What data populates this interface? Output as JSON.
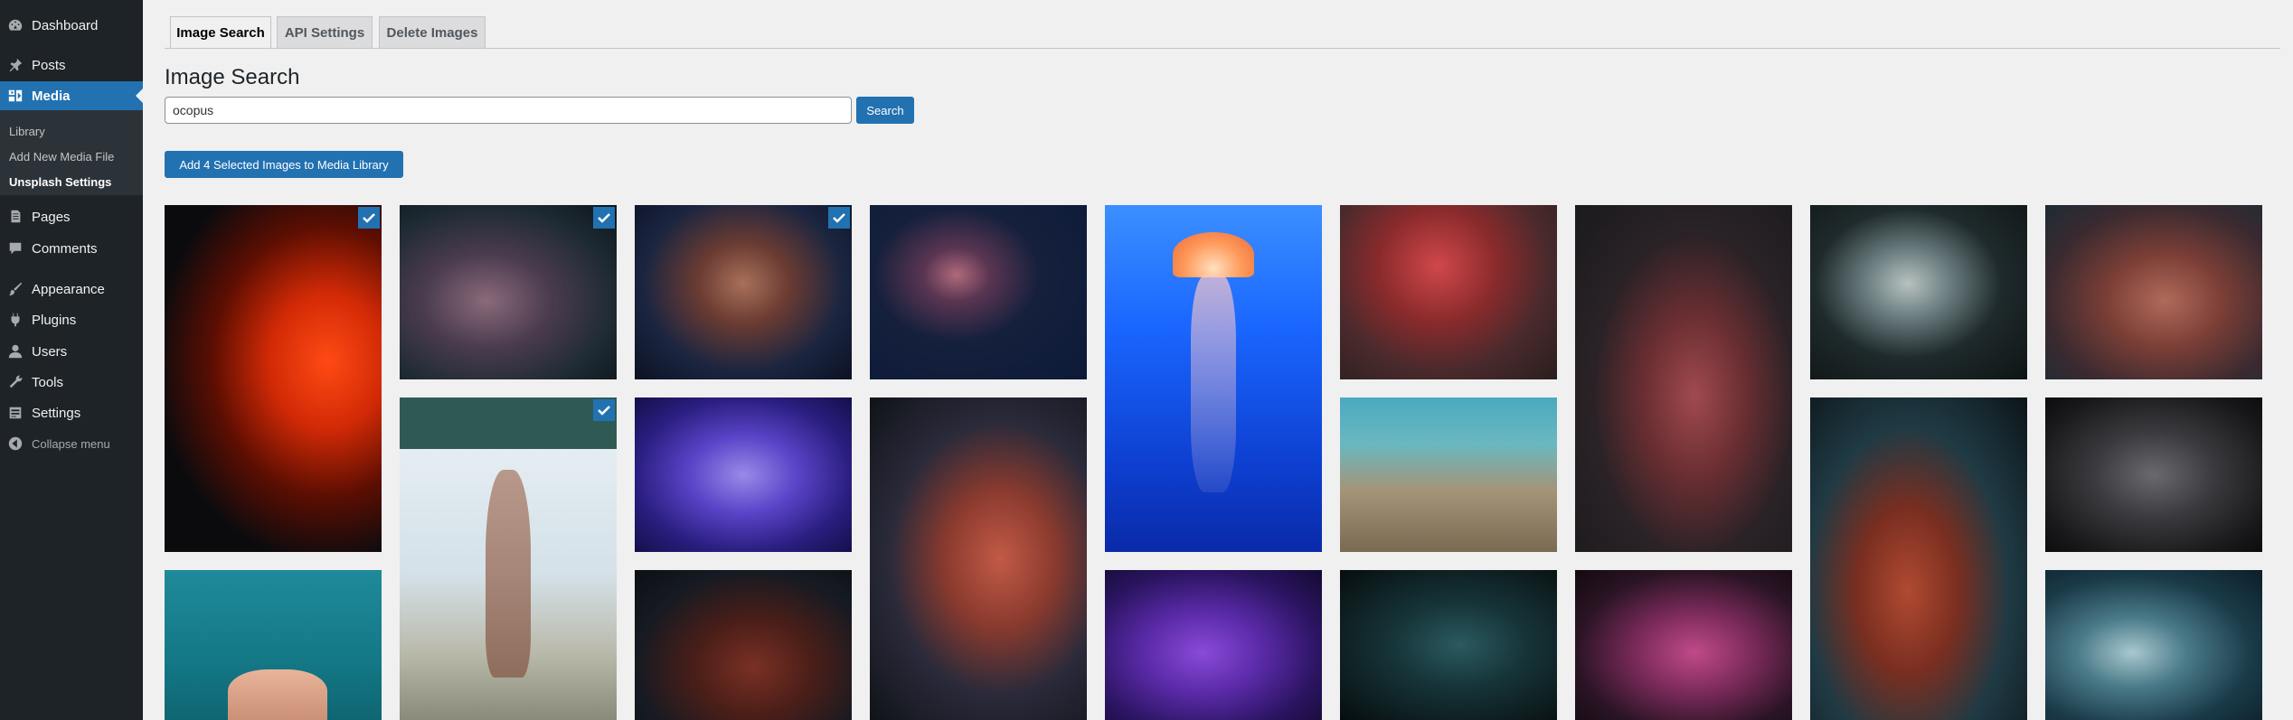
{
  "sidebar": {
    "items": [
      {
        "label": "Dashboard",
        "icon": "dashboard-icon"
      },
      {
        "label": "Posts",
        "icon": "pin-icon"
      },
      {
        "label": "Media",
        "icon": "media-icon"
      },
      {
        "label": "Pages",
        "icon": "pages-icon"
      },
      {
        "label": "Comments",
        "icon": "comment-icon"
      },
      {
        "label": "Appearance",
        "icon": "brush-icon"
      },
      {
        "label": "Plugins",
        "icon": "plug-icon"
      },
      {
        "label": "Users",
        "icon": "user-icon"
      },
      {
        "label": "Tools",
        "icon": "wrench-icon"
      },
      {
        "label": "Settings",
        "icon": "settings-icon"
      }
    ],
    "submenu": [
      "Library",
      "Add New Media File",
      "Unsplash Settings"
    ],
    "collapse_label": "Collapse menu"
  },
  "tabs": [
    {
      "label": "Image Search",
      "active": true
    },
    {
      "label": "API Settings",
      "active": false
    },
    {
      "label": "Delete Images",
      "active": false
    }
  ],
  "page_title": "Image Search",
  "search": {
    "value": "ocopus",
    "button_label": "Search"
  },
  "add_button_label": "Add 4 Selected Images to Media Library",
  "colors": {
    "accent": "#2271b1",
    "sidebar": "#1d2327",
    "background": "#f0f0f1"
  },
  "images": [
    {
      "name": "image-red-octopus-tall",
      "selected": true
    },
    {
      "name": "image-octopus-reef",
      "selected": true
    },
    {
      "name": "image-octopus-aquarium",
      "selected": true
    },
    {
      "name": "image-octopus-swimming",
      "selected": false
    },
    {
      "name": "image-jellyfish",
      "selected": false
    },
    {
      "name": "image-red-octopus-tentacles",
      "selected": false
    },
    {
      "name": "image-octopus-dark-tall",
      "selected": false
    },
    {
      "name": "image-octopus-white",
      "selected": false
    },
    {
      "name": "image-octopus-coral",
      "selected": false
    },
    {
      "name": "image-octopus-drying",
      "selected": true
    },
    {
      "name": "image-purple-tentacles",
      "selected": false
    },
    {
      "name": "image-red-octopus-suckers",
      "selected": false
    },
    {
      "name": "image-octopus-seafloor",
      "selected": false
    },
    {
      "name": "image-red-octopus-teal-tall",
      "selected": false
    },
    {
      "name": "image-grey-tentacles",
      "selected": false
    },
    {
      "name": "image-underwater-hand",
      "selected": false
    },
    {
      "name": "image-octopus-shadow",
      "selected": false
    },
    {
      "name": "image-violet-tentacles",
      "selected": false
    },
    {
      "name": "image-octopus-dark-teal",
      "selected": false
    },
    {
      "name": "image-pink-octopus",
      "selected": false
    },
    {
      "name": "image-octopus-curl",
      "selected": false
    }
  ]
}
